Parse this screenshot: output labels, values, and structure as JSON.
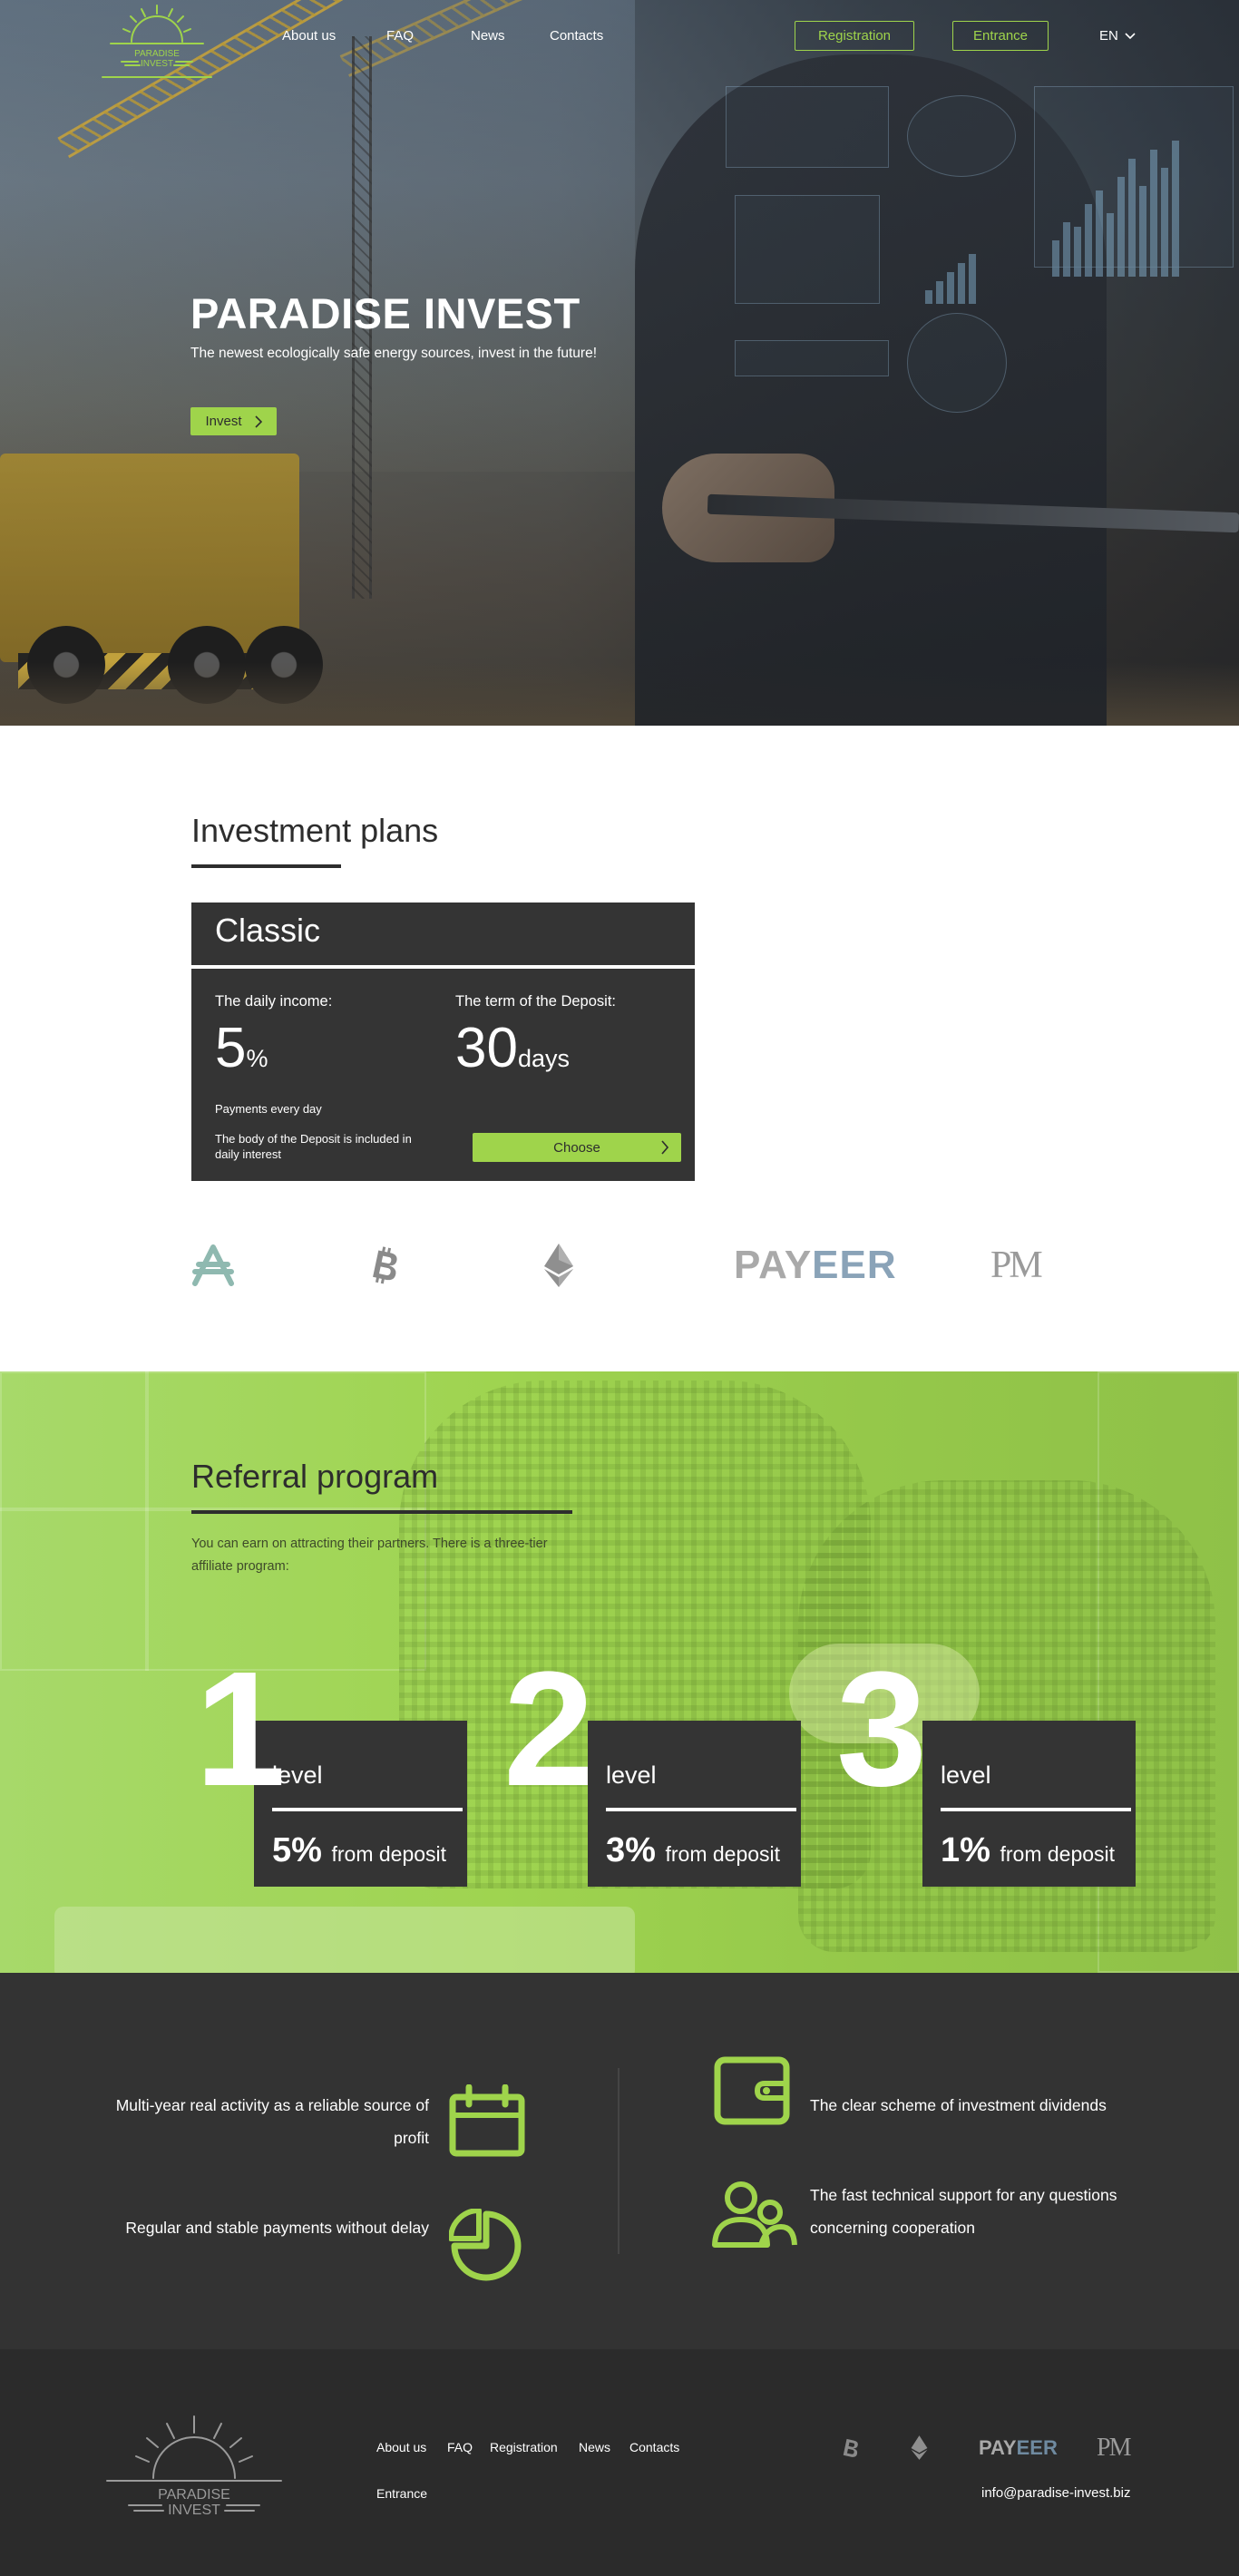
{
  "header": {
    "logo_text_top": "PARADISE",
    "logo_text_bottom": "INVEST",
    "nav": [
      "About us",
      "FAQ",
      "News",
      "Contacts"
    ],
    "registration_label": "Registration",
    "entrance_label": "Entrance",
    "language": "EN"
  },
  "hero": {
    "title": "PARADISE INVEST",
    "subtitle": "The newest ecologically safe energy sources, invest in the future!",
    "invest_label": "Invest"
  },
  "investment": {
    "title": "Investment plans",
    "plan": {
      "name": "Classic",
      "daily_income_label": "The daily income:",
      "daily_income_value": "5",
      "daily_income_unit": "%",
      "term_label": "The term of the Deposit:",
      "term_value": "30",
      "term_unit": "days",
      "note_payments": "Payments every day",
      "note_body": "The body of the Deposit is included in daily interest",
      "choose_label": "Choose"
    },
    "payment_logos": {
      "payeer_a": "PAY",
      "payeer_b": "EER",
      "pm": "PM"
    }
  },
  "referral": {
    "title": "Referral program",
    "description": "You can earn on attracting their partners. There is a three-tier affiliate program:",
    "levels": [
      {
        "number": "1",
        "word": "level",
        "percent": "5%",
        "suffix": "from deposit"
      },
      {
        "number": "2",
        "word": "level",
        "percent": "3%",
        "suffix": "from deposit"
      },
      {
        "number": "3",
        "word": "level",
        "percent": "1%",
        "suffix": "from deposit"
      }
    ]
  },
  "features": {
    "left": [
      {
        "text": "Multi-year real activity as a reliable source of profit",
        "icon": "calendar-icon"
      },
      {
        "text": "Regular and stable payments without delay",
        "icon": "pie-chart-icon"
      }
    ],
    "right": [
      {
        "text": "The clear scheme of investment dividends",
        "icon": "wallet-icon"
      },
      {
        "text": "The fast technical support for any questions concerning cooperation",
        "icon": "support-users-icon"
      }
    ]
  },
  "footer": {
    "logo_text_top": "PARADISE",
    "logo_text_bottom": "INVEST",
    "nav": [
      "About us",
      "FAQ",
      "Registration",
      "News",
      "Contacts",
      "Entrance"
    ],
    "payeer_a": "PAY",
    "payeer_b": "EER",
    "pm": "PM",
    "email": "info@paradise-invest.biz"
  },
  "colors": {
    "accent": "#9fd44b",
    "dark": "#343434",
    "footer": "#2b2b2b"
  }
}
